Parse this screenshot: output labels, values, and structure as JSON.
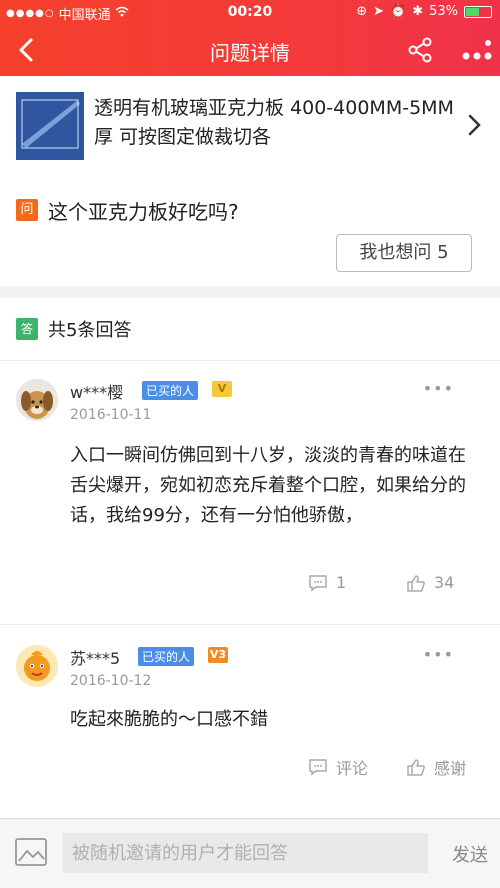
{
  "status": {
    "carrier": "中国联通",
    "time": "00:20",
    "battery": "53%",
    "battery_level": 0.53
  },
  "nav": {
    "title": "问题详情"
  },
  "product": {
    "title": "透明有机玻璃亚克力板 400-400MM-5MM厚 可按图定做裁切各"
  },
  "question": {
    "badge": "问",
    "text": "这个亚克力板好吃吗?",
    "ask_button": "我也想问 5"
  },
  "answers": {
    "badge": "答",
    "count_label": "共5条回答",
    "items": [
      {
        "user": "w***樱",
        "tag": "已买的人",
        "level": "V",
        "date": "2016-10-11",
        "text": "入口一瞬间仿佛回到十八岁，淡淡的青春的味道在舌尖爆开，宛如初恋充斥着整个口腔，如果给分的话，我给99分，还有一分怕他骄傲，",
        "comment": "1",
        "like": "34"
      },
      {
        "user": "苏***5",
        "tag": "已买的人",
        "level": "V3",
        "date": "2016-10-12",
        "text": "吃起來脆脆的～口感不錯",
        "comment": "评论",
        "like": "感谢"
      }
    ]
  },
  "bottom": {
    "placeholder": "被随机邀请的用户才能回答",
    "send": "发送"
  },
  "colors": {
    "brand": "#f43a3a",
    "question_badge": "#f26b1d",
    "answer_badge": "#3db36b",
    "tag": "#4a8ee6"
  }
}
